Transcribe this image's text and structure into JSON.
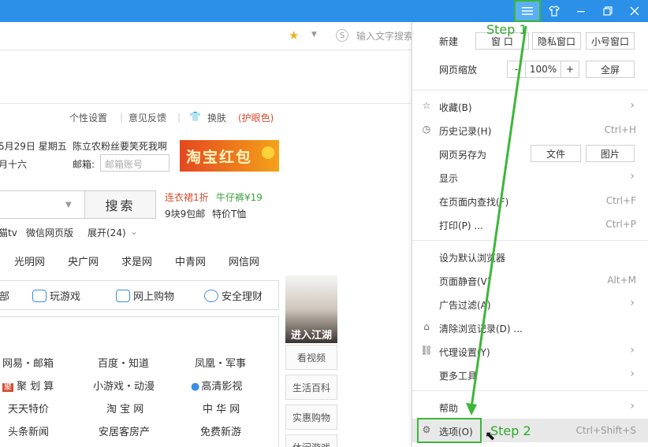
{
  "titlebar": {
    "menu_icon": "hamburger-menu-icon",
    "skin_icon": "shirt-icon",
    "min_icon": "minimize-icon",
    "max_icon": "restore-icon",
    "close_icon": "close-icon",
    "accent": "#2b91e8"
  },
  "toolbar": {
    "search_placeholder": "输入文字搜索"
  },
  "page": {
    "top_links": [
      "个性设置",
      "意见反馈",
      "换肤",
      "(护眼色)"
    ],
    "date_line": "5月29日 星期五",
    "lunar_line": "月十六",
    "news_line": "陈立农粉丝要笑死我啊",
    "email_label": "邮箱:",
    "email_placeholder": "邮箱账号",
    "banner_text": "淘宝红包",
    "search_button": "搜索",
    "promo1_a": "连衣裙1折",
    "promo1_b": "牛仔裤¥19",
    "promo2_a": "9块9包邮",
    "promo2_b": "特价T恤",
    "sub_links": [
      "猫tv",
      "微信网页版",
      "展开(24)"
    ],
    "nav_links": [
      "光明网",
      "央广网",
      "求是网",
      "中青网",
      "网信网"
    ],
    "services": [
      "部",
      "玩游戏",
      "网上购物",
      "安全理财"
    ],
    "links": [
      [
        "网易・邮箱",
        "百度・知道",
        "凤凰・军事"
      ],
      [
        "聚 划 算",
        "小游戏・动漫",
        "高清影视"
      ],
      [
        "天天特价",
        "淘 宝 网",
        "中 华 网"
      ],
      [
        "头条新闻",
        "安居客房产",
        "免费新游"
      ]
    ],
    "game_ad_label": "进入江湖",
    "side_buttons": [
      "看视频",
      "生活百科",
      "实惠购物",
      "休闲游戏"
    ]
  },
  "menu": {
    "new_label": "新建",
    "new_window": "窗 口",
    "private_window": "隐私窗口",
    "small_window": "小号窗口",
    "zoom_label": "网页缩放",
    "zoom_minus": "-",
    "zoom_value": "100%",
    "zoom_plus": "+",
    "fullscreen": "全屏",
    "favorites": "收藏(B)",
    "history": "历史记录(H)",
    "history_shortcut": "Ctrl+H",
    "save_as": "网页另存为",
    "save_file": "文件",
    "save_image": "图片",
    "display": "显示",
    "find": "在页面内查找(F)",
    "find_shortcut": "Ctrl+F",
    "print": "打印(P) ...",
    "print_shortcut": "Ctrl+P",
    "default_browser": "设为默认浏览器",
    "mute": "页面静音(V)",
    "mute_shortcut": "Alt+M",
    "adblock": "广告过滤(A)",
    "clear_history": "清除浏览记录(D) ...",
    "proxy": "代理设置(Y)",
    "more_tools": "更多工具",
    "help": "帮助",
    "options": "选项(O)",
    "options_shortcut": "Ctrl+Shift+S"
  },
  "annotations": {
    "step1": "Step 1",
    "step2": "Step 2",
    "color": "#3db63a"
  }
}
